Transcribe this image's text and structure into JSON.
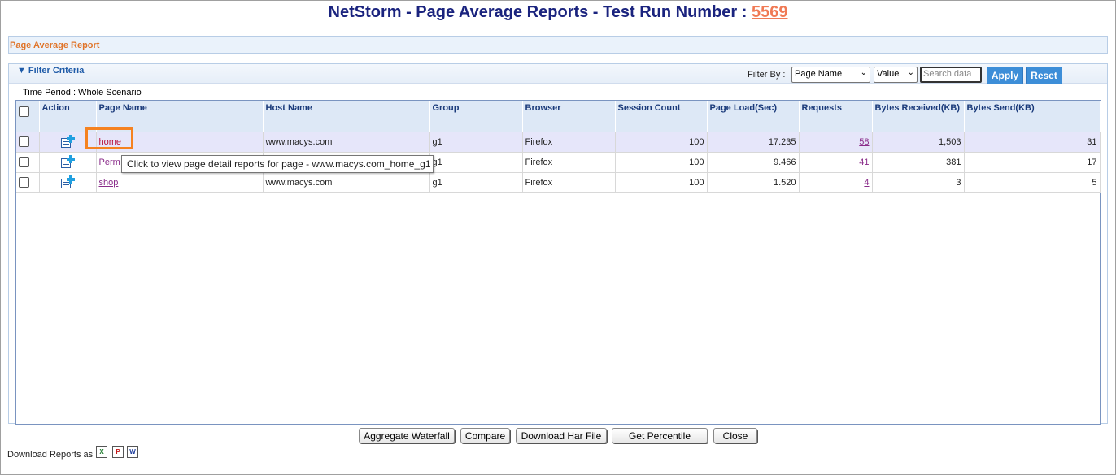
{
  "header": {
    "title_prefix": "NetStorm - Page Average Reports - Test Run Number : ",
    "run_number": "5569"
  },
  "section": {
    "title": "Page Average Report"
  },
  "filter": {
    "toggle_label": "Filter Criteria",
    "filter_by_label": "Filter By :",
    "field_selected": "Page Name",
    "operator_selected": "Value",
    "search_placeholder": "Search data",
    "apply_label": "Apply",
    "reset_label": "Reset",
    "time_period": "Time Period : Whole Scenario"
  },
  "table": {
    "columns": [
      "Action",
      "Page Name",
      "Host Name",
      "Group",
      "Browser",
      "Session Count",
      "Page Load(Sec)",
      "Requests",
      "Bytes Received(KB)",
      "Bytes Send(KB)"
    ],
    "rows": [
      {
        "page": "home",
        "host": "www.macys.com",
        "group": "g1",
        "browser": "Firefox",
        "sessions": "100",
        "load": "17.235",
        "requests": "58",
        "received": "1,503",
        "sent": "31"
      },
      {
        "page": "Perm",
        "host": "",
        "group": "g1",
        "browser": "Firefox",
        "sessions": "100",
        "load": "9.466",
        "requests": "41",
        "received": "381",
        "sent": "17"
      },
      {
        "page": "shop",
        "host": "www.macys.com",
        "group": "g1",
        "browser": "Firefox",
        "sessions": "100",
        "load": "1.520",
        "requests": "4",
        "received": "3",
        "sent": "5"
      }
    ]
  },
  "tooltip": {
    "text": "Click to view page detail reports for page - www.macys.com_home_g1"
  },
  "buttons": {
    "aggregate": "Aggregate Waterfall",
    "compare": "Compare",
    "download_har": "Download Har File",
    "percentile": "Get Percentile",
    "close": "Close"
  },
  "download": {
    "label": "Download Reports as",
    "icons": [
      "excel-icon",
      "pdf-icon",
      "word-icon"
    ]
  },
  "colors": {
    "title": "#1a237e",
    "run_link": "#f07a55",
    "section_title": "#e0752b",
    "highlight": "#f58220",
    "button_blue": "#3d8ed8"
  }
}
